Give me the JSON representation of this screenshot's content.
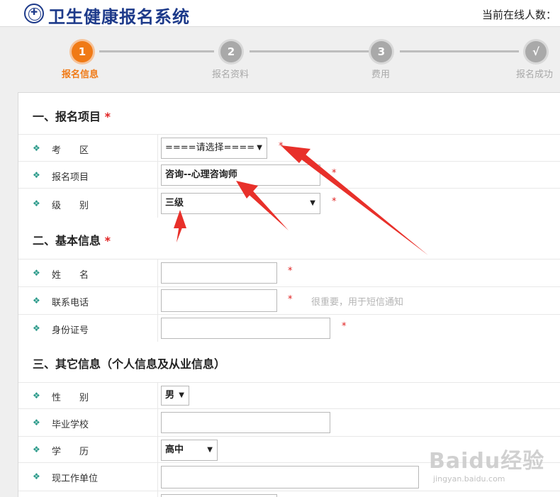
{
  "header": {
    "title": "卫生健康报名系统",
    "online_text": "当前在线人数："
  },
  "steps": [
    {
      "number": "1",
      "label": "报名信息",
      "active": true
    },
    {
      "number": "2",
      "label": "报名资料",
      "active": false
    },
    {
      "number": "3",
      "label": "费用",
      "active": false
    },
    {
      "number": "√",
      "label": "报名成功",
      "active": false
    }
  ],
  "sections": {
    "s1_title": "一、报名项目",
    "s2_title": "二、基本信息",
    "s3_title": "三、其它信息（个人信息及从业信息）",
    "required_mark": "*"
  },
  "form": {
    "exam_area": {
      "label": "考　　区",
      "value": "====请选择===="
    },
    "project": {
      "label": "报名项目",
      "value": "咨询--心理咨询师"
    },
    "level": {
      "label": "级　　别",
      "value": "三级"
    },
    "name": {
      "label": "姓　　名",
      "value": ""
    },
    "phone": {
      "label": "联系电话",
      "value": "",
      "hint": "很重要，用于短信通知"
    },
    "id_number": {
      "label": "身份证号",
      "value": ""
    },
    "gender": {
      "label": "性　　别",
      "value": "男"
    },
    "school": {
      "label": "毕业学校",
      "value": ""
    },
    "education": {
      "label": "学　　历",
      "value": "高中"
    },
    "employer": {
      "label": "现工作单位",
      "value": ""
    }
  },
  "icons": {
    "bullet": "❖",
    "dropdown": "▼"
  },
  "watermark": {
    "main": "Baidu经验",
    "sub": "jingyan.baidu.com"
  },
  "colors": {
    "accent": "#f07a16",
    "brand": "#1d3a8a",
    "required": "#e02020",
    "bullet": "#2b9a8a"
  }
}
